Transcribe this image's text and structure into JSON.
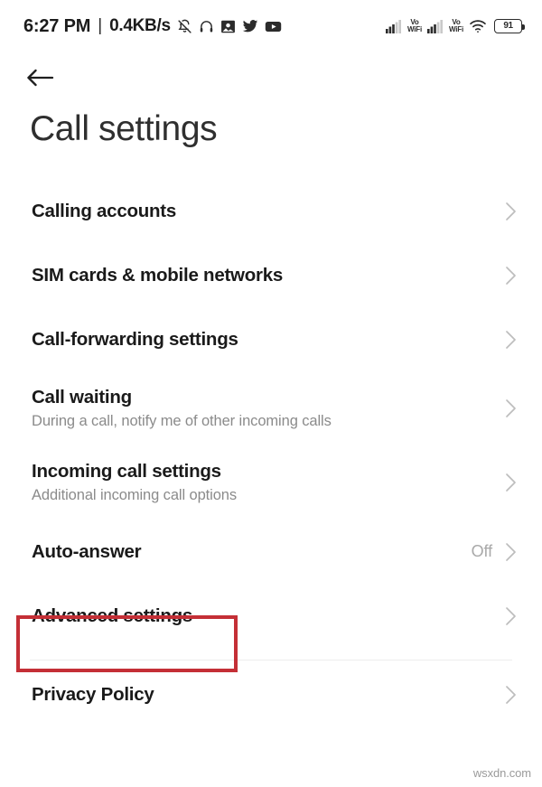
{
  "status_bar": {
    "clock": "6:27 PM",
    "separator": "|",
    "network_speed": "0.4KB/s",
    "left_icons": [
      "notifications-off-icon",
      "headphones-icon",
      "photos-app-icon",
      "twitter-icon",
      "youtube-icon"
    ],
    "sim1_label": "Vo\nWiFi",
    "sim1_line1": "Vo",
    "sim1_line2": "WiFi",
    "sim2_line1": "Vo",
    "sim2_line2": "WiFi",
    "battery_level": "91",
    "right_icons": [
      "signal-icon",
      "vowifi-label",
      "signal-icon",
      "vowifi-label",
      "wifi-icon",
      "battery-icon"
    ]
  },
  "header": {
    "back_icon": "arrow-left-icon",
    "title": "Call settings"
  },
  "list": {
    "items": [
      {
        "title": "Calling accounts",
        "subtitle": "",
        "value": "",
        "chevron": "chevron-right-icon"
      },
      {
        "title": "SIM cards & mobile networks",
        "subtitle": "",
        "value": "",
        "chevron": "chevron-right-icon"
      },
      {
        "title": "Call-forwarding settings",
        "subtitle": "",
        "value": "",
        "chevron": "chevron-right-icon"
      },
      {
        "title": "Call waiting",
        "subtitle": "During a call, notify me of other incoming calls",
        "value": "",
        "chevron": "chevron-right-icon"
      },
      {
        "title": "Incoming call settings",
        "subtitle": "Additional incoming call options",
        "value": "",
        "chevron": "chevron-right-icon"
      },
      {
        "title": "Auto-answer",
        "subtitle": "",
        "value": "Off",
        "chevron": "chevron-right-icon"
      },
      {
        "title": "Advanced settings",
        "subtitle": "",
        "value": "",
        "chevron": "chevron-right-icon"
      }
    ],
    "footer_items": [
      {
        "title": "Privacy Policy",
        "subtitle": "",
        "value": "",
        "chevron": "chevron-right-icon"
      }
    ]
  },
  "annotation": {
    "target": "Advanced settings",
    "color": "#c42f36"
  },
  "watermark": {
    "text": "wsxdn.com"
  },
  "colors": {
    "background": "#ffffff",
    "title": "#2f2f2f",
    "row_title": "#1a1a1a",
    "row_subtitle": "#8b8b8b",
    "row_value": "#a9a9a9",
    "chevron": "#bdbdbd",
    "divider": "#ededed",
    "annotation_red": "#c42f36"
  }
}
